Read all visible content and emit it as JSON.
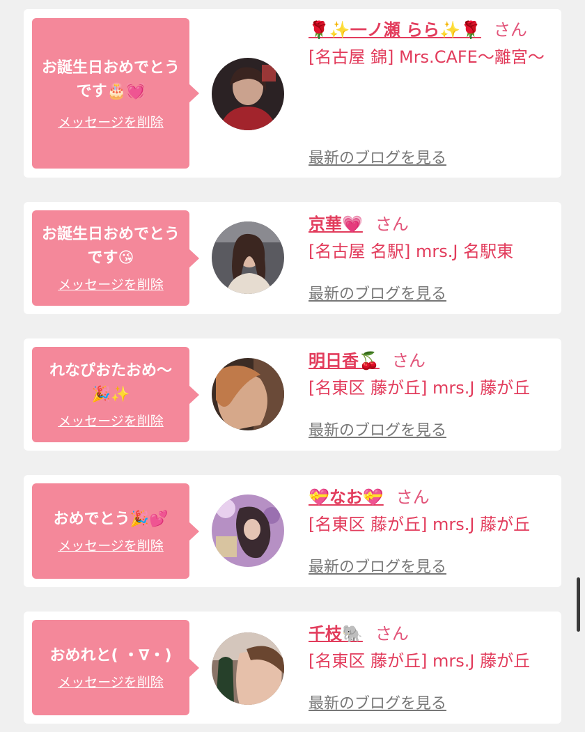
{
  "delete_label": "メッセージを削除",
  "san_label": "さん",
  "blog_label": "最新のブログを見る",
  "colors": {
    "bubble": "#f4889a",
    "accent": "#e23c5c",
    "card": "#ffffff",
    "background": "#f0f0f0"
  },
  "cards": [
    {
      "message": "お誕生日おめでとうです🎂💓",
      "name": "🌹✨一ノ瀬 らら✨🌹",
      "shop": "[名古屋 錦] Mrs.CAFE〜離宮〜"
    },
    {
      "message": "お誕生日おめでとうです😘",
      "name": "京華💗",
      "shop": "[名古屋 名駅] mrs.J 名駅東"
    },
    {
      "message": "れなぴおたおめ〜🎉✨",
      "name": "明日香🍒",
      "shop": "[名東区 藤が丘] mrs.J 藤が丘"
    },
    {
      "message": "おめでとう🎉💕",
      "name": "💝なお💝",
      "shop": "[名東区 藤が丘] mrs.J 藤が丘"
    },
    {
      "message": "おめれと( ・∇・)",
      "name": "千枝🐘",
      "shop": "[名東区 藤が丘] mrs.J 藤が丘"
    }
  ]
}
